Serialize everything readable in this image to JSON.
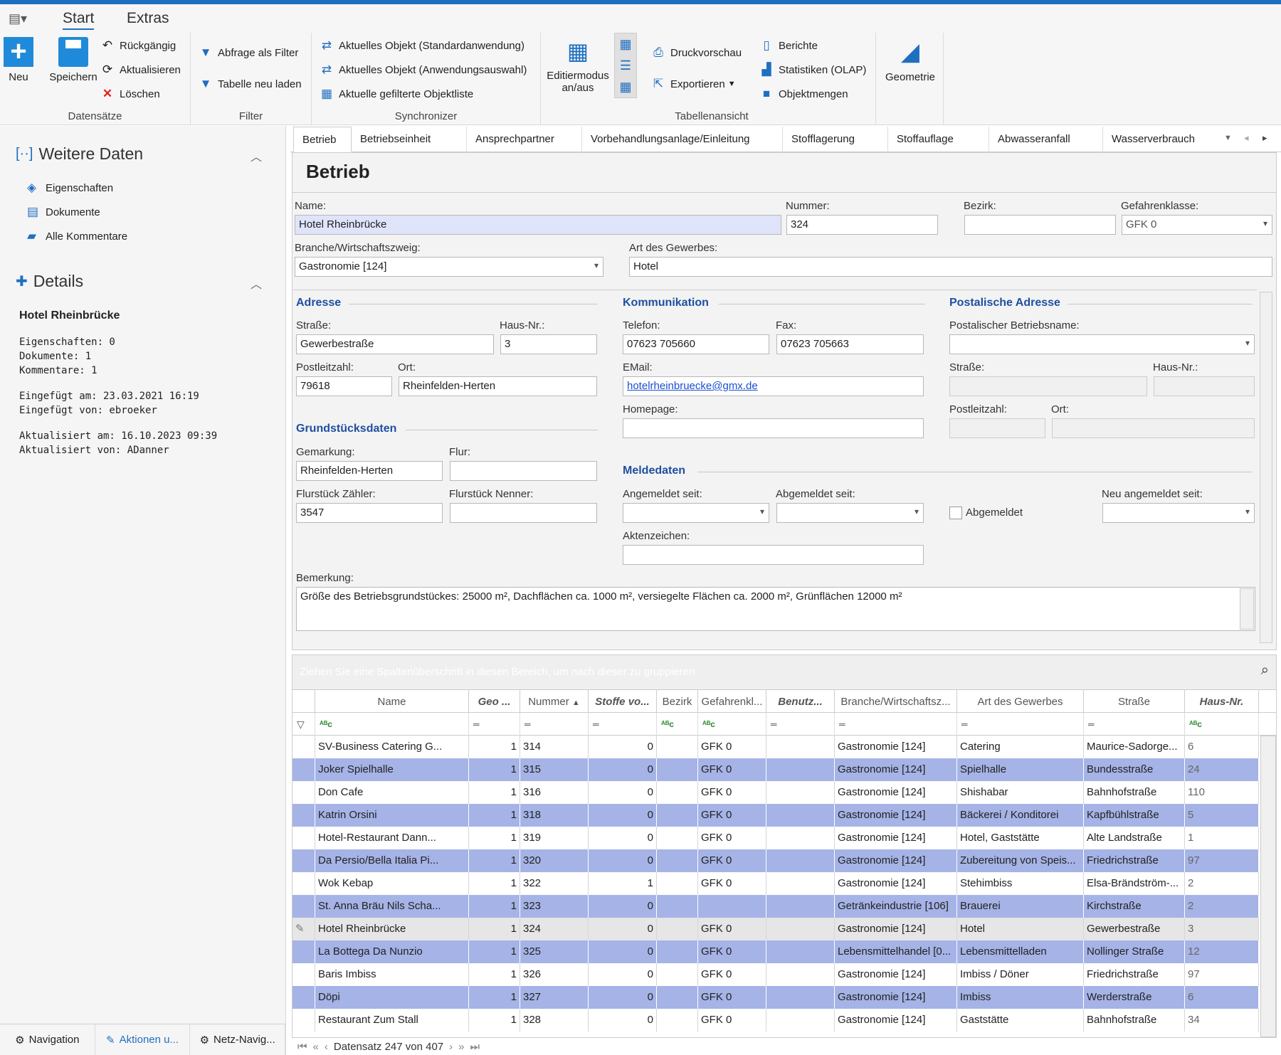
{
  "ribbon": {
    "tabs": [
      "Start",
      "Extras"
    ],
    "groups": {
      "datensaetze": "Datensätze",
      "filter": "Filter",
      "synchronizer": "Synchronizer",
      "tabellenansicht": "Tabellenansicht"
    },
    "neu": "Neu",
    "speichern": "Speichern",
    "rueckgaengig": "Rückgängig",
    "aktualisieren": "Aktualisieren",
    "loeschen": "Löschen",
    "abfrage_filter": "Abfrage als Filter",
    "tabelle_neu": "Tabelle neu laden",
    "sync1": "Aktuelles Objekt (Standardanwendung)",
    "sync2": "Aktuelles Objekt (Anwendungsauswahl)",
    "sync3": "Aktuelle gefilterte Objektliste",
    "editiermodus": "Editiermodus",
    "editiermodus2": "an/aus",
    "druckvorschau": "Druckvorschau",
    "exportieren": "Exportieren",
    "berichte": "Berichte",
    "statistiken": "Statistiken (OLAP)",
    "objektmengen": "Objektmengen",
    "geometrie": "Geometrie"
  },
  "left": {
    "weitere": "Weitere Daten",
    "eigenschaften": "Eigenschaften",
    "dokumente": "Dokumente",
    "kommentare": "Alle Kommentare",
    "details": "Details",
    "name": "Hotel Rheinbrücke",
    "info": [
      "Eigenschaften: 0",
      "Dokumente: 1",
      "Kommentare: 1",
      "Eingefügt am: 23.03.2021 16:19",
      "Eingefügt von: ebroeker",
      "Aktualisiert am: 16.10.2023 09:39",
      "Aktualisiert von: ADanner"
    ],
    "nav": [
      "Navigation",
      "Aktionen u...",
      "Netz-Navig..."
    ]
  },
  "tabs": [
    "Betrieb",
    "Betriebseinheit",
    "Ansprechpartner",
    "Vorbehandlungsanlage/Einleitung",
    "Stofflagerung",
    "Stoffauflage",
    "Abwasseranfall",
    "Wasserverbrauch"
  ],
  "form": {
    "title": "Betrieb",
    "name_l": "Name:",
    "name": "Hotel Rheinbrücke",
    "nummer_l": "Nummer:",
    "nummer": "324",
    "bezirk_l": "Bezirk:",
    "bezirk": "",
    "gefahr_l": "Gefahrenklasse:",
    "gefahr": "GFK 0",
    "branche_l": "Branche/Wirtschaftszweig:",
    "branche": "Gastronomie [124]",
    "art_l": "Art des Gewerbes:",
    "art": "Hotel",
    "adresse": "Adresse",
    "strasse_l": "Straße:",
    "strasse": "Gewerbestraße",
    "hausnr_l": "Haus-Nr.:",
    "hausnr": "3",
    "plz_l": "Postleitzahl:",
    "plz": "79618",
    "ort_l": "Ort:",
    "ort": "Rheinfelden-Herten",
    "grund": "Grundstücksdaten",
    "gemarkung_l": "Gemarkung:",
    "gemarkung": "Rheinfelden-Herten",
    "flur_l": "Flur:",
    "flur": "",
    "fz_l": "Flurstück Zähler:",
    "fz": "3547",
    "fn_l": "Flurstück Nenner:",
    "fn": "",
    "komm": "Kommunikation",
    "tel_l": "Telefon:",
    "tel": "07623 705660",
    "fax_l": "Fax:",
    "fax": "07623 705663",
    "email_l": "EMail:",
    "email": "hotelrheinbruecke@gmx.de",
    "home_l": "Homepage:",
    "home": "",
    "melde": "Meldedaten",
    "angem_l": "Angemeldet seit:",
    "abgem_l": "Abgemeldet seit:",
    "abgem_chk": "Abgemeldet",
    "neuangem_l": "Neu angemeldet seit:",
    "akten_l": "Aktenzeichen:",
    "post": "Postalische Adresse",
    "pname_l": "Postalischer Betriebsname:",
    "pstr_l": "Straße:",
    "phnr_l": "Haus-Nr.:",
    "pplz_l": "Postleitzahl:",
    "port_l": "Ort:",
    "bem_l": "Bemerkung:",
    "bem": "Größe des Betriebsgrundstückes: 25000 m², Dachflächen ca. 1000 m², versiegelte Flächen ca. 2000 m², Grünflächen 12000 m²"
  },
  "grid": {
    "groupbar": "Ziehen Sie eine Spaltenüberschrift in diesen Bereich, um nach dieser zu gruppieren",
    "cols": [
      "Name",
      "Geo ...",
      "Nummer",
      "Stoffe vo...",
      "Bezirk",
      "Gefahrenkl...",
      "Benutz...",
      "Branche/Wirtschaftsz...",
      "Art des Gewerbes",
      "Straße",
      "Haus-Nr."
    ],
    "rows": [
      [
        "SV-Business Catering G...",
        "1",
        "314",
        "0",
        "",
        "GFK 0",
        "",
        "Gastronomie [124]",
        "Catering",
        "Maurice-Sadorge...",
        "6"
      ],
      [
        "Joker Spielhalle",
        "1",
        "315",
        "0",
        "",
        "GFK 0",
        "",
        "Gastronomie [124]",
        "Spielhalle",
        "Bundesstraße",
        "24"
      ],
      [
        "Don Cafe",
        "1",
        "316",
        "0",
        "",
        "GFK 0",
        "",
        "Gastronomie [124]",
        "Shishabar",
        "Bahnhofstraße",
        "110"
      ],
      [
        "Katrin Orsini",
        "1",
        "318",
        "0",
        "",
        "GFK 0",
        "",
        "Gastronomie [124]",
        "Bäckerei / Konditorei",
        "Kapfbühlstraße",
        "5"
      ],
      [
        "Hotel-Restaurant Dann...",
        "1",
        "319",
        "0",
        "",
        "GFK 0",
        "",
        "Gastronomie [124]",
        "Hotel, Gaststätte",
        "Alte Landstraße",
        "1"
      ],
      [
        "Da Persio/Bella Italia Pi...",
        "1",
        "320",
        "0",
        "",
        "GFK 0",
        "",
        "Gastronomie [124]",
        "Zubereitung von Speis...",
        "Friedrichstraße",
        "97"
      ],
      [
        "Wok Kebap",
        "1",
        "322",
        "1",
        "",
        "GFK 0",
        "",
        "Gastronomie [124]",
        "Stehimbiss",
        "Elsa-Brändström-...",
        "2"
      ],
      [
        "St. Anna Bräu Nils Scha...",
        "1",
        "323",
        "0",
        "",
        "",
        "",
        "Getränkeindustrie [106]",
        "Brauerei",
        "Kirchstraße",
        "2"
      ],
      [
        "Hotel Rheinbrücke",
        "1",
        "324",
        "0",
        "",
        "GFK 0",
        "",
        "Gastronomie [124]",
        "Hotel",
        "Gewerbestraße",
        "3"
      ],
      [
        "La Bottega Da Nunzio",
        "1",
        "325",
        "0",
        "",
        "GFK 0",
        "",
        "Lebensmittelhandel [0...",
        "Lebensmittelladen",
        "Nollinger Straße",
        "12"
      ],
      [
        "Baris Imbiss",
        "1",
        "326",
        "0",
        "",
        "GFK 0",
        "",
        "Gastronomie [124]",
        "Imbiss / Döner",
        "Friedrichstraße",
        "97"
      ],
      [
        "Döpi",
        "1",
        "327",
        "0",
        "",
        "GFK 0",
        "",
        "Gastronomie [124]",
        "Imbiss",
        "Werderstraße",
        "6"
      ],
      [
        "Restaurant Zum Stall",
        "1",
        "328",
        "0",
        "",
        "GFK 0",
        "",
        "Gastronomie [124]",
        "Gaststätte",
        "Bahnhofstraße",
        "34"
      ]
    ],
    "pager": "Datensatz 247 von 407"
  },
  "colors": {
    "accent": "#1f6fc1",
    "row_alt": "#a5b3e6",
    "name_highlight": "#dfe4fb"
  }
}
